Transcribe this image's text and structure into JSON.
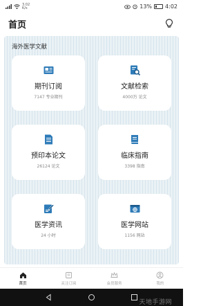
{
  "status_bar": {
    "net_speed_top": "3.02",
    "net_speed_bottom": "K/s",
    "battery": "13%",
    "time": "4:02"
  },
  "header": {
    "title": "首页",
    "icon": "lightbulb-icon"
  },
  "section": {
    "title": "海外医学文献"
  },
  "cards": [
    {
      "label": "期刊订阅",
      "sub": "7147 专业期刊",
      "icon": "newspaper-icon"
    },
    {
      "label": "文献检索",
      "sub": "4000万 论文",
      "icon": "search-document-icon"
    },
    {
      "label": "预印本论文",
      "sub": "26124 论文",
      "icon": "document-icon"
    },
    {
      "label": "临床指南",
      "sub": "3398 指南",
      "icon": "book-icon"
    },
    {
      "label": "医学资讯",
      "sub": "24 小时",
      "icon": "edit-document-icon"
    },
    {
      "label": "医学网站",
      "sub": "1156 网站",
      "icon": "website-icon"
    }
  ],
  "bottom_nav": [
    {
      "label": "首页",
      "icon": "home-icon",
      "active": true
    },
    {
      "label": "关注订阅",
      "icon": "bookmark-icon",
      "active": false
    },
    {
      "label": "会员服务",
      "icon": "crown-icon",
      "active": false
    },
    {
      "label": "我的",
      "icon": "user-icon",
      "active": false
    }
  ],
  "watermark": "天地手游网",
  "colors": {
    "accent": "#2e7bb8",
    "card_background": "#ffffff",
    "content_background": "#eaf2f6"
  }
}
